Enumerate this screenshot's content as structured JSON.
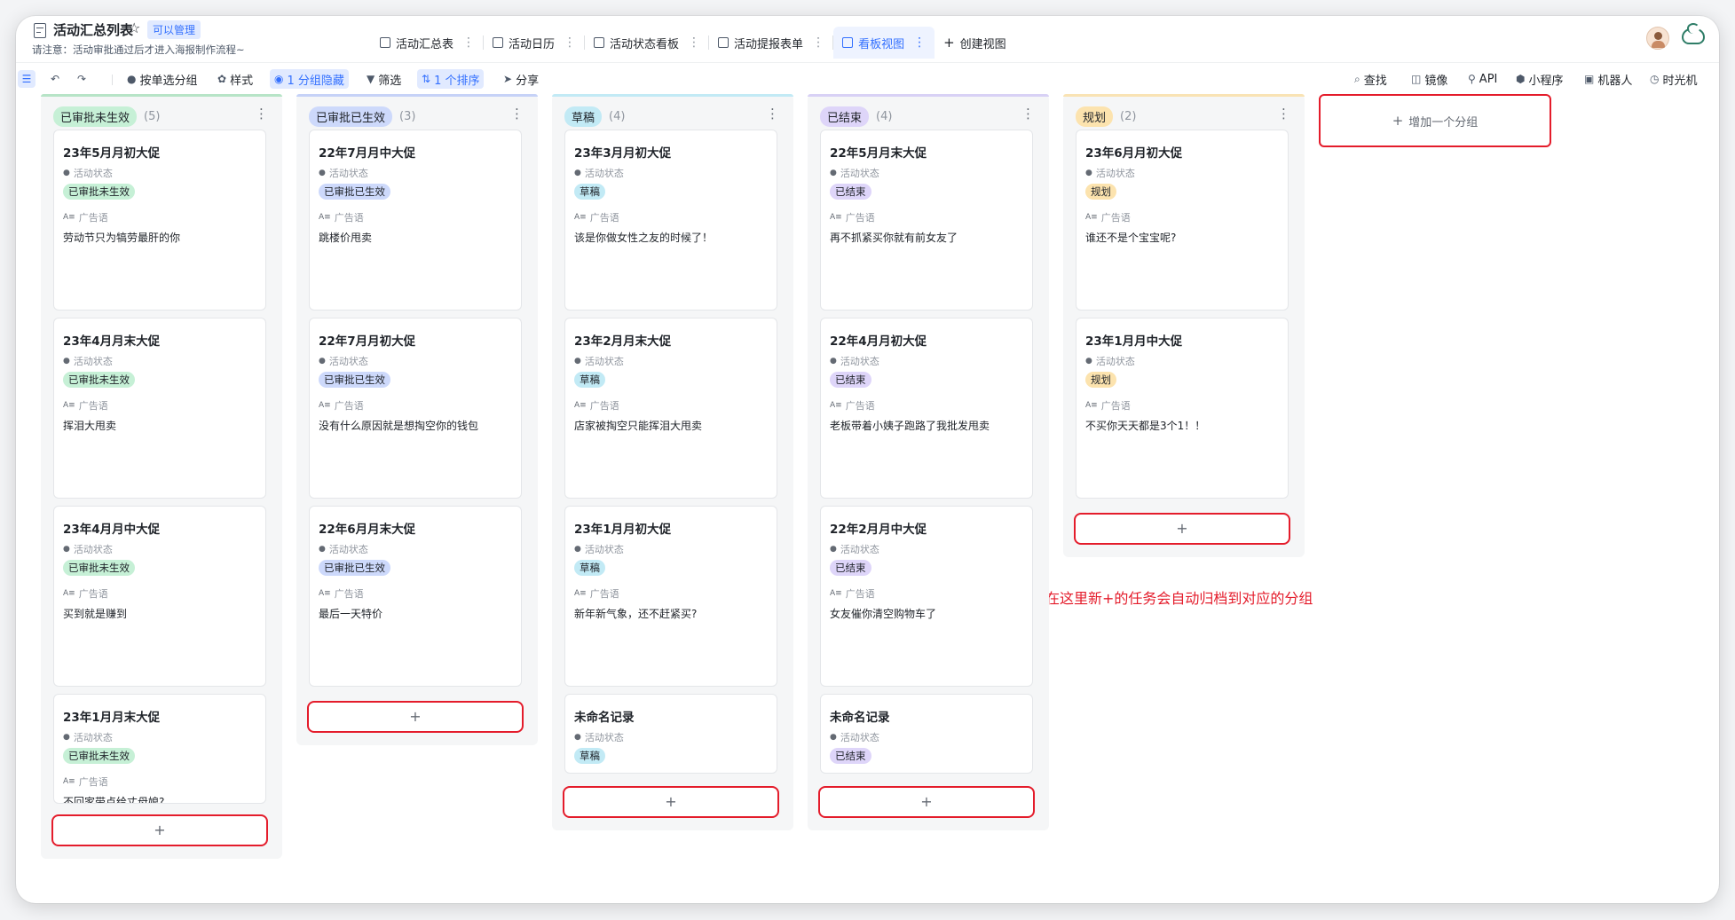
{
  "header": {
    "title": "活动汇总列表",
    "permission": "可以管理",
    "description": "请注意：活动审批通过后才进入海报制作流程~",
    "tabs": [
      {
        "label": "活动汇总表"
      },
      {
        "label": "活动日历"
      },
      {
        "label": "活动状态看板"
      },
      {
        "label": "活动提报表单"
      },
      {
        "label": "看板视图"
      },
      {
        "label": "创建视图"
      }
    ]
  },
  "toolbar": {
    "group_by": "按单选分组",
    "style": "样式",
    "hidden_groups": "1 分组隐藏",
    "filter": "筛选",
    "sort": "1 个排序",
    "share": "分享",
    "find": "查找",
    "mirror": "镜像",
    "api": "API",
    "mini_program": "小程序",
    "robot": "机器人",
    "time_machine": "时光机"
  },
  "field_labels": {
    "status": "活动状态",
    "slogan": "广告语"
  },
  "columns": [
    {
      "name": "已审批未生效",
      "count": "(5)",
      "tag_color": "#c6f0d6",
      "accent": "#b7e4c7",
      "cards": [
        {
          "title": "23年5月月初大促",
          "status": "已审批未生效",
          "slogan": "劳动节只为犒劳最肝的你"
        },
        {
          "title": "23年4月月末大促",
          "status": "已审批未生效",
          "slogan": "挥泪大甩卖"
        },
        {
          "title": "23年4月月中大促",
          "status": "已审批未生效",
          "slogan": "买到就是赚到"
        },
        {
          "title": "23年1月月末大促",
          "status": "已审批未生效",
          "slogan": "不回家带点给丈母娘?"
        }
      ]
    },
    {
      "name": "已审批已生效",
      "count": "(3)",
      "tag_color": "#cdd9fb",
      "accent": "#c6d2f7",
      "cards": [
        {
          "title": "22年7月月中大促",
          "status": "已审批已生效",
          "slogan": "跳楼价甩卖"
        },
        {
          "title": "22年7月月初大促",
          "status": "已审批已生效",
          "slogan": "没有什么原因就是想掏空你的钱包"
        },
        {
          "title": "22年6月月末大促",
          "status": "已审批已生效",
          "slogan": "最后一天特价"
        }
      ]
    },
    {
      "name": "草稿",
      "count": "(4)",
      "tag_color": "#c2eaf5",
      "accent": "#c2eaf5",
      "cards": [
        {
          "title": "23年3月月初大促",
          "status": "草稿",
          "slogan": "该是你做女性之友的时候了！"
        },
        {
          "title": "23年2月月末大促",
          "status": "草稿",
          "slogan": "店家被掏空只能挥泪大甩卖"
        },
        {
          "title": "23年1月月初大促",
          "status": "草稿",
          "slogan": "新年新气象，还不赶紧买?"
        },
        {
          "title": "未命名记录",
          "status": "草稿",
          "slogan": ""
        }
      ]
    },
    {
      "name": "已结束",
      "count": "(4)",
      "tag_color": "#ded5f9",
      "accent": "#d8d1f5",
      "cards": [
        {
          "title": "22年5月月末大促",
          "status": "已结束",
          "slogan": "再不抓紧买你就有前女友了"
        },
        {
          "title": "22年4月月初大促",
          "status": "已结束",
          "slogan": "老板带着小姨子跑路了我批发甩卖"
        },
        {
          "title": "22年2月月中大促",
          "status": "已结束",
          "slogan": "女友催你清空购物车了"
        },
        {
          "title": "未命名记录",
          "status": "已结束",
          "slogan": ""
        }
      ]
    },
    {
      "name": "规划",
      "count": "(2)",
      "tag_color": "#fce3ae",
      "accent": "#f9e3b4",
      "cards": [
        {
          "title": "23年6月月初大促",
          "status": "规划",
          "slogan": "谁还不是个宝宝呢?"
        },
        {
          "title": "23年1月月中大促",
          "status": "规划",
          "slogan": "不买你天天都是3个1！！"
        }
      ]
    }
  ],
  "add_card_label": "+",
  "add_group_label": "增加一个分组",
  "annotation": "在这里新+的任务会自动归档到对应的分组"
}
